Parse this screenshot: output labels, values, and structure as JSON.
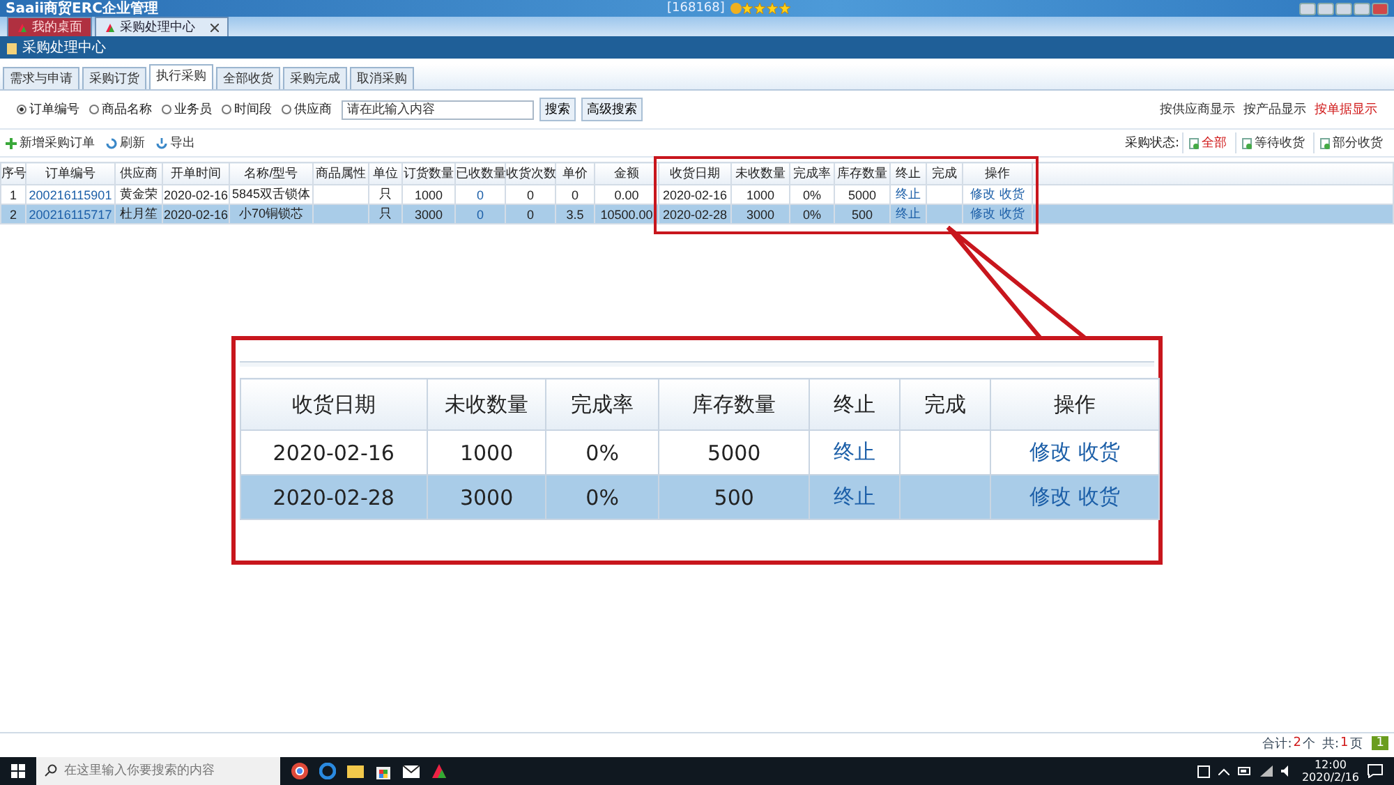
{
  "app_title": "Saaii商贸ERC企业管理",
  "user_id": "[168168]",
  "user_rating": {
    "stars": 4
  },
  "doc_tabs": [
    {
      "label": "我的桌面",
      "selected": false
    },
    {
      "label": "采购处理中心",
      "selected": true
    }
  ],
  "panel_title": "采购处理中心",
  "tabs": [
    {
      "label": "需求与申请",
      "selected": false
    },
    {
      "label": "采购订货",
      "selected": false
    },
    {
      "label": "执行采购",
      "selected": true
    },
    {
      "label": "全部收货",
      "selected": false
    },
    {
      "label": "采购完成",
      "selected": false
    },
    {
      "label": "取消采购",
      "selected": false
    }
  ],
  "search": {
    "options": [
      {
        "label": "订单编号",
        "selected": true
      },
      {
        "label": "商品名称",
        "selected": false
      },
      {
        "label": "业务员",
        "selected": false
      },
      {
        "label": "时间段",
        "selected": false
      },
      {
        "label": "供应商",
        "selected": false
      }
    ],
    "value": "请在此输入内容",
    "buttons": [
      "搜索",
      "高级搜索"
    ]
  },
  "view_links": [
    {
      "label": "按供应商显示",
      "selected": false
    },
    {
      "label": "按产品显示",
      "selected": false
    },
    {
      "label": "按单据显示",
      "selected": true
    }
  ],
  "toolbar": [
    {
      "label": "新增采购订单",
      "kind": "add"
    },
    {
      "label": "刷新",
      "kind": "refresh"
    },
    {
      "label": "导出",
      "kind": "export"
    }
  ],
  "status_filter": {
    "label": "采购状态:",
    "options": [
      {
        "label": "全部",
        "selected": true
      },
      {
        "label": "等待收货",
        "selected": false
      },
      {
        "label": "部分收货",
        "selected": false
      }
    ]
  },
  "table": {
    "columns": [
      {
        "label": "序号",
        "kind": "text"
      },
      {
        "label": "订单编号",
        "kind": "link"
      },
      {
        "label": "供应商",
        "kind": "bold"
      },
      {
        "label": "开单时间",
        "kind": "text"
      },
      {
        "label": "名称/型号",
        "kind": "text"
      },
      {
        "label": "商品属性"
      },
      {
        "label": "单位",
        "kind": "text"
      },
      {
        "label": "订货数量",
        "kind": "text"
      },
      {
        "label": "已收数量",
        "kind": "link"
      },
      {
        "label": "收货次数",
        "kind": "text"
      },
      {
        "label": "单价",
        "kind": "text"
      },
      {
        "label": "金额",
        "kind": "text"
      },
      {
        "label": "收货日期",
        "kind": "text"
      },
      {
        "label": "未收数量",
        "kind": "text"
      },
      {
        "label": "完成率",
        "kind": "text"
      },
      {
        "label": "库存数量",
        "kind": "text"
      },
      {
        "label": "终止",
        "kind": "link"
      },
      {
        "label": "完成"
      },
      {
        "label": "操作",
        "kind": "actions"
      }
    ],
    "rows": [
      {
        "selected": false,
        "cells": [
          "1",
          "200216115901",
          "黄金荣",
          "2020-02-16",
          "5845双舌锁体",
          null,
          "只",
          "1000",
          "0",
          "0",
          "0",
          "0.00",
          "2020-02-16",
          "1000",
          "0%",
          "5000",
          "终止",
          null,
          [
            "修改",
            "收货"
          ]
        ]
      },
      {
        "selected": true,
        "cells": [
          "2",
          "200216115717",
          "杜月笙",
          "2020-02-16",
          "小70铜锁芯",
          null,
          "只",
          "3000",
          "0",
          "0",
          "3.5",
          "10500.00",
          "2020-02-28",
          "3000",
          "0%",
          "500",
          "终止",
          null,
          [
            "修改",
            "收货"
          ]
        ]
      }
    ]
  },
  "callout": {
    "columns": [
      {
        "label": "收货日期",
        "kind": "text"
      },
      {
        "label": "未收数量",
        "kind": "text"
      },
      {
        "label": "完成率",
        "kind": "text"
      },
      {
        "label": "库存数量",
        "kind": "text"
      },
      {
        "label": "终止",
        "kind": "link"
      },
      {
        "label": "完成"
      },
      {
        "label": "操作",
        "kind": "actions"
      }
    ],
    "rows": [
      {
        "selected": false,
        "cells": [
          "2020-02-16",
          "1000",
          "0%",
          "5000",
          "终止",
          null,
          [
            "修改",
            "收货"
          ]
        ]
      },
      {
        "selected": true,
        "cells": [
          "2020-02-28",
          "3000",
          "0%",
          "500",
          "终止",
          null,
          [
            "修改",
            "收货"
          ]
        ]
      }
    ]
  },
  "footer": {
    "total_label": "合计:",
    "total": "2",
    "total_unit": "个",
    "pages_label": "共:",
    "pages": "1",
    "pages_unit": "页",
    "current_page": "1"
  },
  "taskbar": {
    "search_placeholder": "在这里输入你要搜索的内容",
    "time": "12:00",
    "date": "2020/2/16"
  }
}
